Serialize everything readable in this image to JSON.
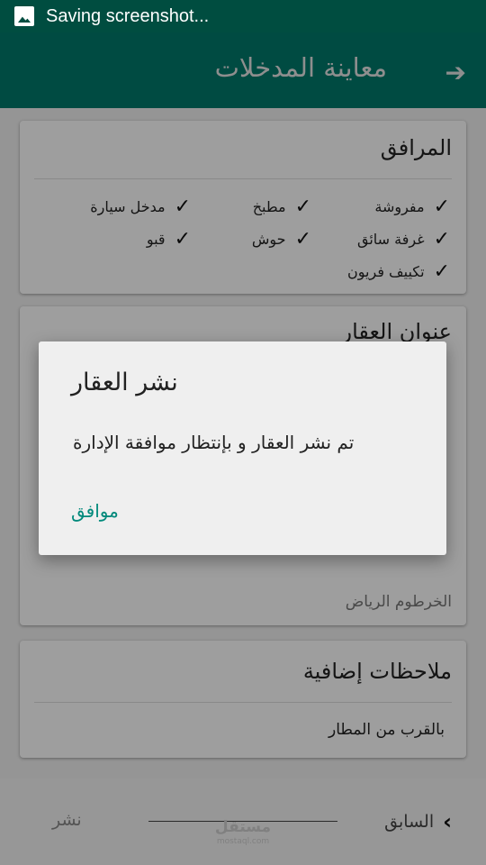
{
  "status_bar": {
    "text": "Saving screenshot...",
    "icon": "image-icon"
  },
  "app_bar": {
    "title": "معاينة المدخلات",
    "back_icon": "arrow-forward-icon"
  },
  "facilities": {
    "title": "المرافق",
    "items": [
      {
        "label": "مفروشة",
        "checked": true
      },
      {
        "label": "مطبخ",
        "checked": true
      },
      {
        "label": "مدخل سيارة",
        "checked": true
      },
      {
        "label": "غرفة سائق",
        "checked": true
      },
      {
        "label": "حوش",
        "checked": true
      },
      {
        "label": "قبو",
        "checked": true
      },
      {
        "label": "تكييف فريون",
        "checked": true
      }
    ]
  },
  "address": {
    "title": "عنوان العقار",
    "value": "الخرطوم الرياض"
  },
  "notes": {
    "title": "ملاحظات إضافية",
    "value": "بالقرب من المطار"
  },
  "bottom_bar": {
    "previous_label": "السابق",
    "publish_label": "نشر",
    "watermark_main": "مستقل",
    "watermark_sub": "mostaql.com"
  },
  "dialog": {
    "title": "نشر العقار",
    "message": "تم نشر العقار و بإنتظار موافقة الإدارة",
    "ok_label": "موافق"
  },
  "colors": {
    "status_bar": "#004d40",
    "app_bar": "#00796b",
    "accent": "#00897b"
  }
}
